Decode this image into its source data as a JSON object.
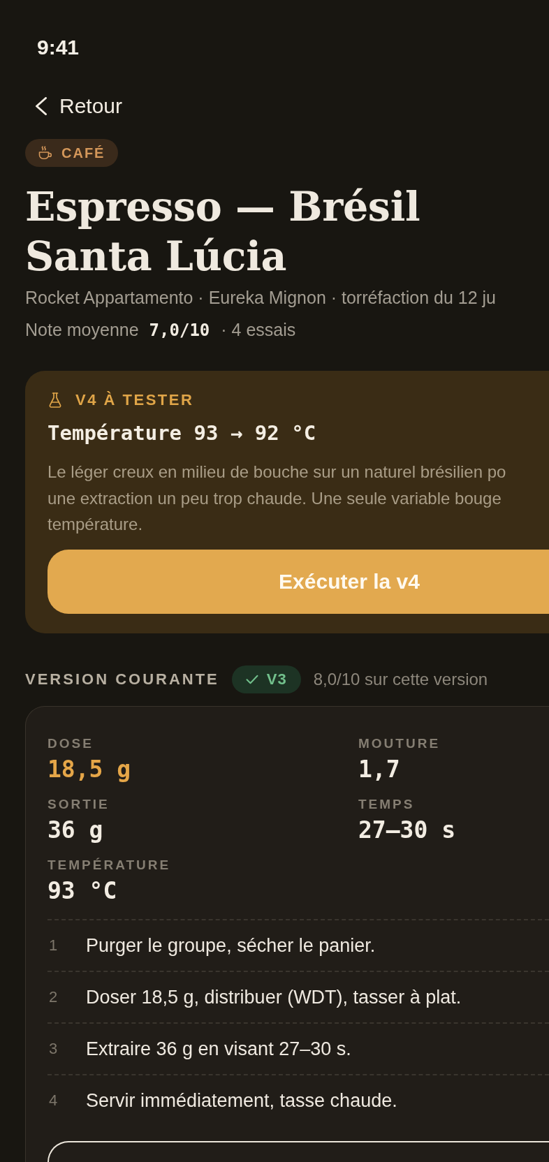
{
  "status_bar": {
    "time": "9:41"
  },
  "navigation": {
    "back_label": "Retour"
  },
  "category": {
    "label": "CAFÉ"
  },
  "header": {
    "title": "Espresso — Brésil Santa Lúcia",
    "subtitle": "Rocket Appartamento · Eureka Mignon · torréfaction du 12 ju",
    "rating_label": "Note moyenne",
    "rating_value": "7,0/10",
    "trial_count": "· 4 essais"
  },
  "next_test": {
    "badge": "V4 À TESTER",
    "change": "Température 93 → 92 °C",
    "rationale_lines": [
      "Le léger creux en milieu de bouche sur un naturel brésilien po",
      "une extraction un peu trop chaude. Une seule variable bouge",
      "température."
    ],
    "button": "Exécuter la v4"
  },
  "current_version": {
    "heading": "VERSION COURANTE",
    "version": "V3",
    "score": "8,0/10 sur cette version",
    "parameters": [
      {
        "label": "DOSE",
        "value": "18,5 g",
        "highlighted": true
      },
      {
        "label": "MOUTURE",
        "value": "1,7",
        "highlighted": false
      },
      {
        "label": "SORTIE",
        "value": "36 g",
        "highlighted": false
      },
      {
        "label": "TEMPS",
        "value": "27–30 s",
        "highlighted": false
      },
      {
        "label": "TEMPÉRATURE",
        "value": "93 °C",
        "highlighted": false
      }
    ],
    "steps": [
      {
        "number": "1",
        "text": "Purger le groupe, sécher le panier."
      },
      {
        "number": "2",
        "text": "Doser 18,5 g, distribuer (WDT), tasser à plat."
      },
      {
        "number": "3",
        "text": "Extraire 36 g en visant 27–30 s."
      },
      {
        "number": "4",
        "text": "Servir immédiatement, tasse chaude."
      }
    ]
  }
}
